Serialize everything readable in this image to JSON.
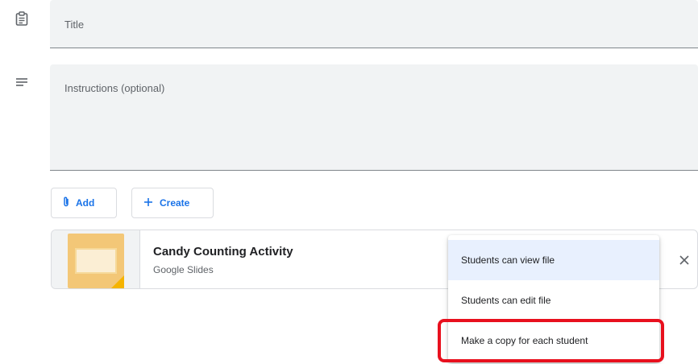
{
  "form": {
    "title_placeholder": "Title",
    "instructions_placeholder": "Instructions (optional)"
  },
  "buttons": {
    "add_label": "Add",
    "create_label": "Create"
  },
  "attachment": {
    "title": "Candy Counting Activity",
    "type": "Google Slides"
  },
  "menu": {
    "items": [
      {
        "label": "Students can view file",
        "selected": true
      },
      {
        "label": "Students can edit file",
        "selected": false
      },
      {
        "label": "Make a copy for each student",
        "selected": false
      }
    ]
  },
  "icons": {
    "title_field": "assignment-icon",
    "instructions_field": "notes-icon",
    "add": "paperclip-icon",
    "create": "plus-icon",
    "remove": "close-icon"
  },
  "colors": {
    "accent": "#1a73e8",
    "selected_bg": "#e8f0fe",
    "highlight": "#e8101e",
    "slides_yellow": "#f5b400"
  }
}
